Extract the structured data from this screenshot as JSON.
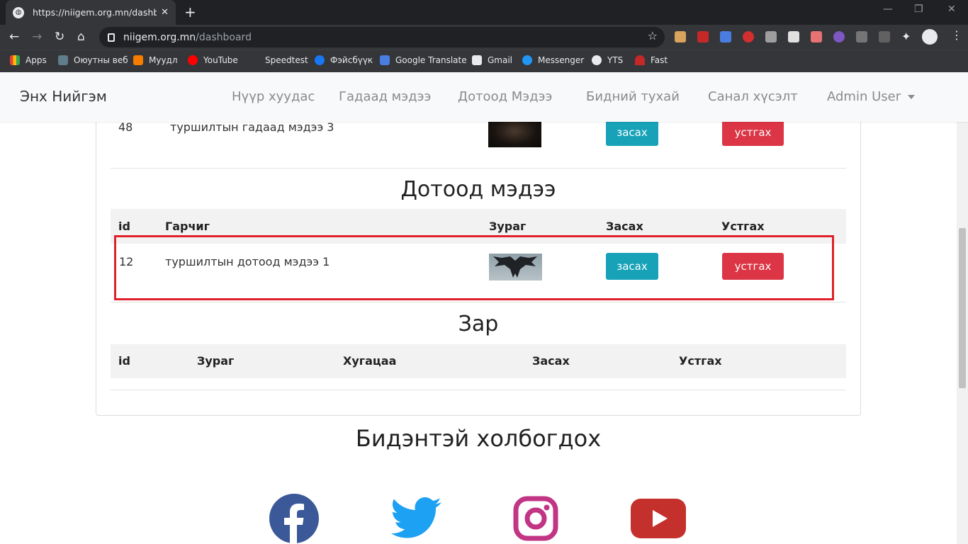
{
  "browser": {
    "tab_title": "https://niigem.org.mn/dashboard",
    "url_host": "niigem.org.mn",
    "url_path": "/dashboard",
    "bookmarks": [
      "Apps",
      "Оюутны веб",
      "Муудл",
      "YouTube",
      "Speedtest",
      "Фэйсбүүк",
      "Google Translate",
      "Gmail",
      "Messenger",
      "YTS",
      "Fast"
    ]
  },
  "site": {
    "brand": "Энх Нийгэм",
    "nav": [
      "Нүүр хуудас",
      "Гадаад мэдээ",
      "Дотоод Мэдээ",
      "Бидний тухай",
      "Санал хүсэлт",
      "Admin User"
    ]
  },
  "foreign_row": {
    "id": "48",
    "title": "туршилтын гадаад мэдээ 3",
    "edit": "засах",
    "delete": "устгах"
  },
  "domestic": {
    "title": "Дотоод мэдээ",
    "headers": [
      "id",
      "Гарчиг",
      "Зураг",
      "Засах",
      "Устгах"
    ],
    "row": {
      "id": "12",
      "title": "туршилтын дотоод мэдээ 1",
      "edit": "засах",
      "delete": "устгах"
    }
  },
  "ads": {
    "title": "Зар",
    "headers": [
      "id",
      "Зураг",
      "Хугацаа",
      "Засах",
      "Устгах"
    ]
  },
  "contact": {
    "title": "Бидэнтэй холбогдох"
  },
  "colors": {
    "edit": "#17a2b8",
    "delete": "#dc3545",
    "highlight": "#e0202a"
  }
}
